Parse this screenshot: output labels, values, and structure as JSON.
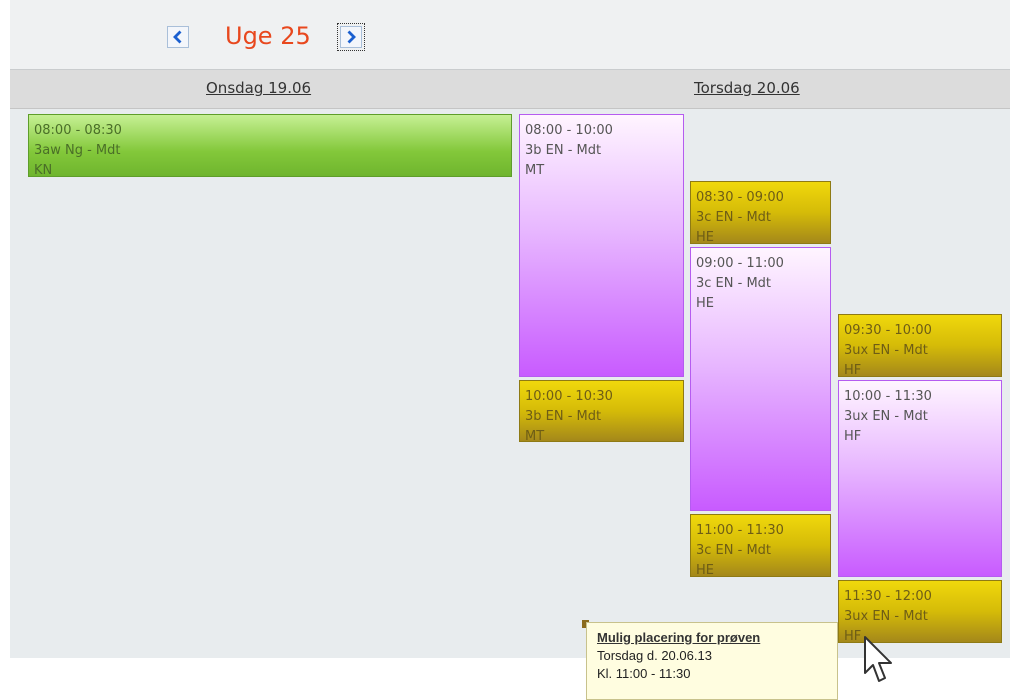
{
  "header": {
    "week_title": "Uge 25",
    "prev_icon": "chevron-left-icon",
    "next_icon": "chevron-right-icon"
  },
  "days": [
    {
      "label": "Onsdag 19.06"
    },
    {
      "label": "Torsdag 20.06"
    }
  ],
  "events": [
    {
      "time": "08:00 - 08:30",
      "class": "3aw Ng - Mdt",
      "teacher": "KN",
      "color": "green"
    },
    {
      "time": "08:00 - 10:00",
      "class": "3b EN - Mdt",
      "teacher": "MT",
      "color": "purple"
    },
    {
      "time": "10:00 - 10:30",
      "class": "3b EN - Mdt",
      "teacher": "MT",
      "color": "yellow"
    },
    {
      "time": "08:30 - 09:00",
      "class": "3c EN - Mdt",
      "teacher": "HE",
      "color": "yellow"
    },
    {
      "time": "09:00 - 11:00",
      "class": "3c EN - Mdt",
      "teacher": "HE",
      "color": "purple"
    },
    {
      "time": "11:00 - 11:30",
      "class": "3c EN - Mdt",
      "teacher": "HE",
      "color": "yellow"
    },
    {
      "time": "09:30 - 10:00",
      "class": "3ux EN - Mdt",
      "teacher": "HF",
      "color": "yellow"
    },
    {
      "time": "10:00 - 11:30",
      "class": "3ux EN - Mdt",
      "teacher": "HF",
      "color": "purple"
    },
    {
      "time": "11:30 - 12:00",
      "class": "3ux EN - Mdt",
      "teacher": "HF",
      "color": "yellow"
    }
  ],
  "tooltip": {
    "title": "Mulig placering for prøven",
    "date": "Torsdag d. 20.06.13",
    "time": "Kl. 11:00 - 11:30"
  },
  "colors": {
    "week_title": "#e8481e",
    "green": "#83c83a",
    "purple": "#c85bff",
    "yellow": "#d5bb08"
  }
}
